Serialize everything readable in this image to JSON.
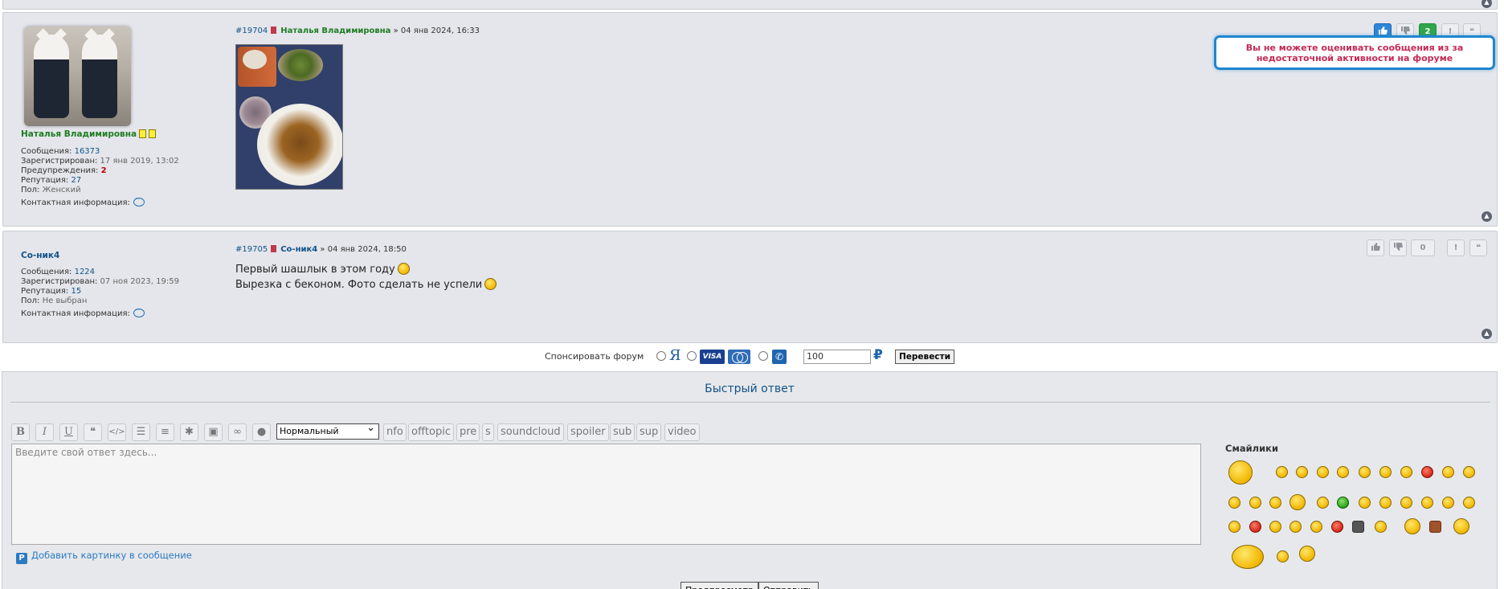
{
  "posts": [
    {
      "id": "#19704",
      "author": "Наталья Владимировна",
      "date": "» 04 янв 2024, 16:33",
      "profile": {
        "messages_label": "Сообщения:",
        "messages": "16373",
        "registered_label": "Зарегистрирован:",
        "registered": "17 янв 2019, 13:02",
        "warnings_label": "Предупреждения:",
        "warnings": "2",
        "reputation_label": "Репутация:",
        "reputation": "27",
        "gender_label": "Пол:",
        "gender": "Женский",
        "contact_label": "Контактная информация:"
      },
      "score": "2"
    },
    {
      "id": "#19705",
      "author": "Со-ник4",
      "date": "» 04 янв 2024, 18:50",
      "profile": {
        "messages_label": "Сообщения:",
        "messages": "1224",
        "registered_label": "Зарегистрирован:",
        "registered": "07 ноя 2023, 19:59",
        "reputation_label": "Репутация:",
        "reputation": "15",
        "gender_label": "Пол:",
        "gender": "Не выбран",
        "contact_label": "Контактная информация:"
      },
      "score": "0",
      "lines": [
        "Первый шашлык в этом году",
        "Вырезка с беконом. Фото сделать не успели"
      ]
    }
  ],
  "tooltip": "Вы не можете оценивать сообщения из за недостаточной активности на форуме",
  "sponsor": {
    "label": "Спонсировать форум",
    "yandex": "Я",
    "visa": "VISA",
    "amount": "100",
    "currency": "₽",
    "translate_button": "Перевести"
  },
  "quick_reply": {
    "title": "Быстрый ответ",
    "font_select": "Нормальный",
    "text_buttons": [
      "nfo",
      "offtopic",
      "pre",
      "s",
      "soundcloud",
      "spoiler",
      "sub",
      "sup",
      "video"
    ],
    "placeholder": "Введите свой ответ здесь...",
    "add_image": "Добавить картинку в сообщение",
    "smilies_title": "Смайлики",
    "preview_button": "Предпросмотр",
    "submit_button": "Отправить"
  },
  "colors": {
    "accent": "#105289",
    "author_green": "#1e7c22",
    "tooltip_text": "#c42a54",
    "tooltip_border": "#1e86cf"
  }
}
